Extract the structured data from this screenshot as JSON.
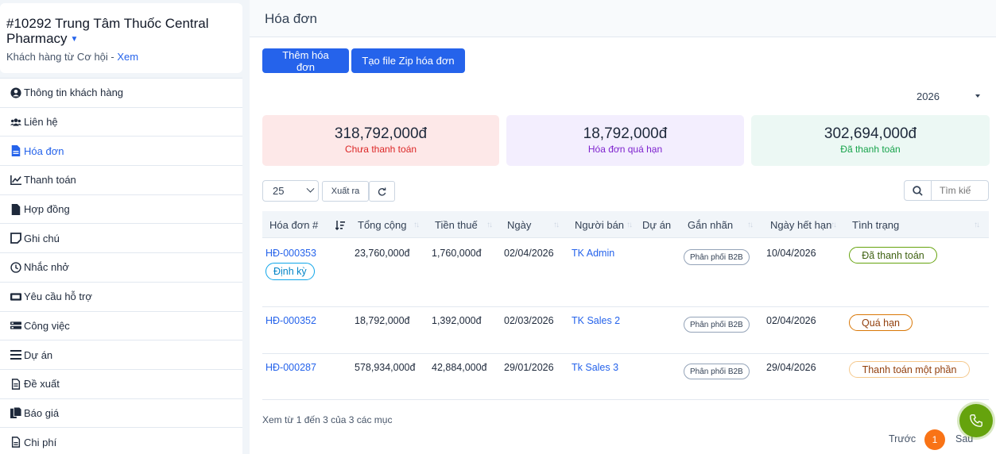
{
  "customer": {
    "title": "#10292 Trung Tâm Thuốc Central Pharmacy",
    "subtitle_prefix": "Khách hàng từ Cơ hội - ",
    "subtitle_link": "Xem"
  },
  "sidebar": {
    "items": [
      {
        "label": "Thông tin khách hàng",
        "icon": "user-circle-icon"
      },
      {
        "label": "Liên hệ",
        "icon": "users-icon"
      },
      {
        "label": "Hóa đơn",
        "icon": "file-invoice-icon",
        "active": true
      },
      {
        "label": "Thanh toán",
        "icon": "line-chart-icon"
      },
      {
        "label": "Hợp đồng",
        "icon": "file-icon"
      },
      {
        "label": "Ghi chú",
        "icon": "note-icon"
      },
      {
        "label": "Nhắc nhở",
        "icon": "clock-icon"
      },
      {
        "label": "Yêu cầu hỗ trợ",
        "icon": "ticket-icon"
      },
      {
        "label": "Công việc",
        "icon": "tasks-icon"
      },
      {
        "label": "Dự án",
        "icon": "bars-icon"
      },
      {
        "label": "Đề xuất",
        "icon": "file-text-icon"
      },
      {
        "label": "Báo giá",
        "icon": "copy-icon"
      },
      {
        "label": "Chi phí",
        "icon": "file-lines-icon"
      }
    ]
  },
  "main": {
    "title": "Hóa đơn",
    "add_invoice_label": "Thêm hóa đơn",
    "zip_label": "Tạo file Zip hóa đơn",
    "year": "2026",
    "stats": [
      {
        "value": "318,792,000đ",
        "label": "Chưa thanh toán",
        "bg": "#fde8e8",
        "color": "#dc2626"
      },
      {
        "value": "18,792,000đ",
        "label": "Hóa đơn quá hạn",
        "bg": "#f3eefe",
        "color": "#7e22ce"
      },
      {
        "value": "302,694,000đ",
        "label": "Đã thanh toán",
        "bg": "#ecf8f4",
        "color": "#16a34a"
      }
    ],
    "page_length": "25",
    "export_label": "Xuất ra",
    "search_placeholder": "Tìm kiế",
    "columns": [
      "Hóa đơn #",
      "Tổng cộng",
      "Tiền thuế",
      "Ngày",
      "Người bán",
      "Dự án",
      "Gắn nhãn",
      "Ngày hết hạn",
      "Tình trạng"
    ],
    "rows": [
      {
        "id": "HĐ-000353",
        "total": "23,760,000đ",
        "tax": "1,760,000đ",
        "date": "02/04/2026",
        "seller": "TK Admin",
        "project": "",
        "tag": "Phân phối B2B",
        "due": "10/04/2026",
        "status": "Đã thanh toán",
        "status_style": "green",
        "recurring": "Định kỳ"
      },
      {
        "id": "HĐ-000352",
        "total": "18,792,000đ",
        "tax": "1,392,000đ",
        "date": "02/03/2026",
        "seller": "TK Sales 2",
        "project": "",
        "tag": "Phân phối B2B",
        "due": "02/04/2026",
        "status": "Quá hạn",
        "status_style": "orange"
      },
      {
        "id": "HĐ-000287",
        "total": "578,934,000đ",
        "tax": "42,884,000đ",
        "date": "29/01/2026",
        "seller": "Tk Sales 3",
        "project": "",
        "tag": "Phân phối B2B",
        "due": "29/04/2026",
        "status": "Thanh toán một phần",
        "status_style": "peach"
      }
    ],
    "info": "Xem từ 1 đến 3 của 3 các mục",
    "prev_label": "Trước",
    "current_page": "1",
    "next_label": "Sau"
  }
}
